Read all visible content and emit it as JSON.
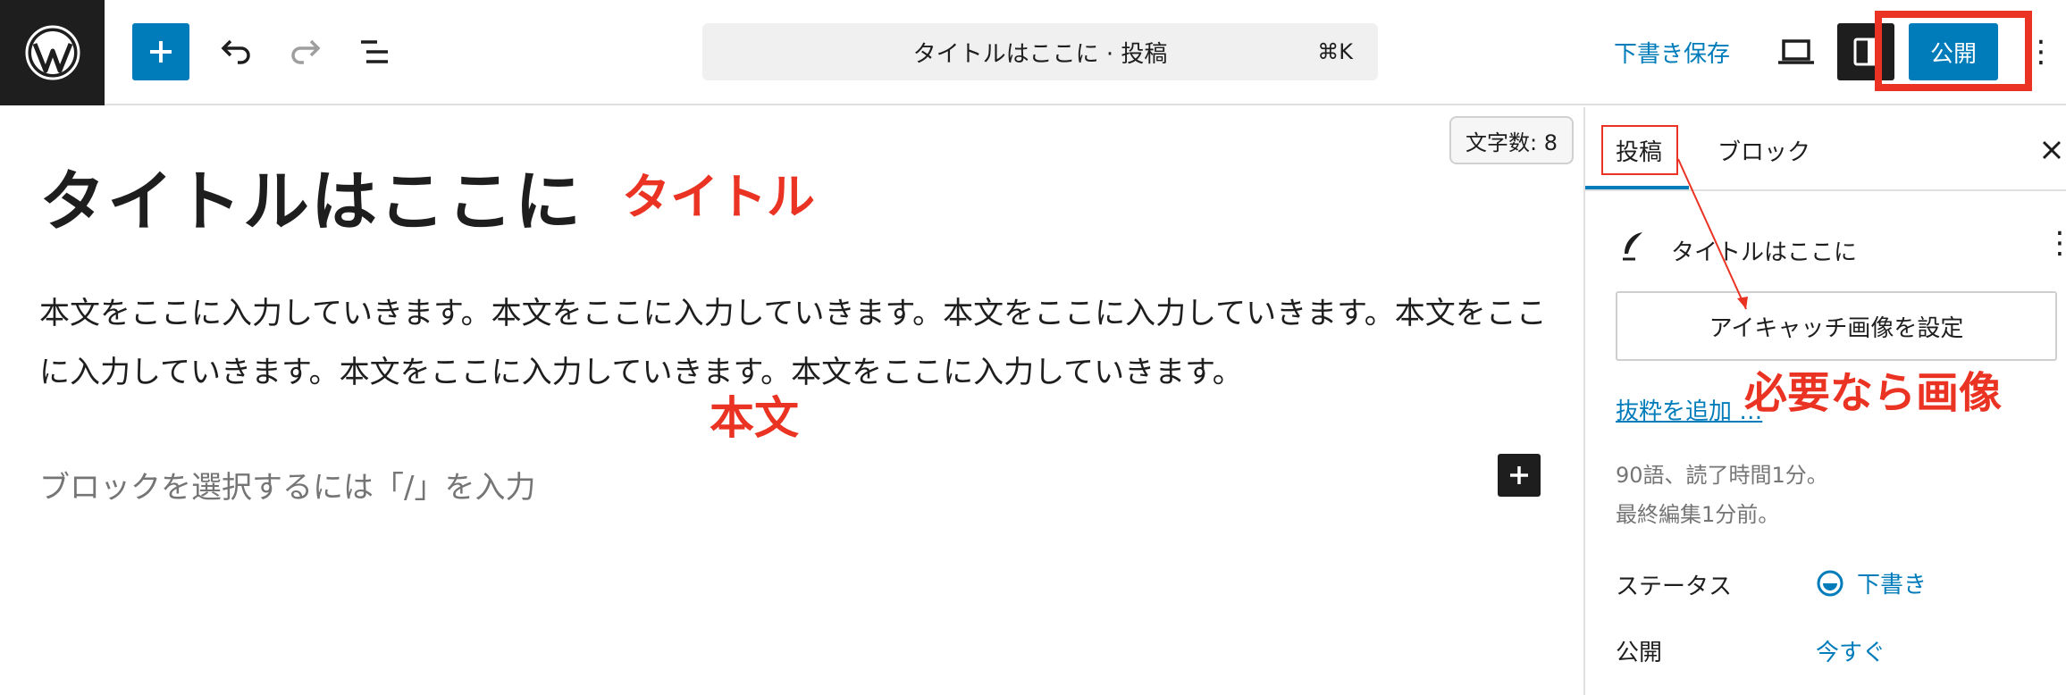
{
  "toolbar": {
    "logo_icon": "wordpress-logo-icon",
    "add_icon": "plus-icon",
    "undo_icon": "undo-icon",
    "redo_icon": "redo-icon",
    "list_view_icon": "list-view-icon",
    "command_title": "タイトルはここに · 投稿",
    "command_shortcut": "⌘K",
    "save_draft": "下書き保存",
    "preview_icon": "laptop-icon",
    "settings_icon": "sidebar-toggle-icon",
    "publish": "公開",
    "more_icon": "more-vertical-icon"
  },
  "editor": {
    "word_count": "文字数: 8",
    "title": "タイトルはここに",
    "title_annotation": "タイトル",
    "body": "本文をここに入力していきます。本文をここに入力していきます。本文をここに入力していきます。本文をここに入力していきます。本文をここに入力していきます。本文をここに入力していきます。",
    "body_annotation": "本文",
    "block_placeholder": "ブロックを選択するには「/」を入力"
  },
  "sidebar": {
    "tabs": [
      {
        "label": "投稿"
      },
      {
        "label": "ブロック"
      }
    ],
    "summary_title": "タイトルはここに",
    "featured_image_button": "アイキャッチ画像を設定",
    "featured_image_annotation": "必要なら画像",
    "excerpt_link": "抜粋を追加 …",
    "meta_words": "90語、読了時間1分。",
    "meta_last_edited": "最終編集1分前。",
    "status_label": "ステータス",
    "status_value": "下書き",
    "publish_label": "公開",
    "publish_value": "今すぐ"
  },
  "colors": {
    "accent": "#007cba",
    "annotation_red": "#ea3323",
    "dark": "#1e1e1e"
  }
}
